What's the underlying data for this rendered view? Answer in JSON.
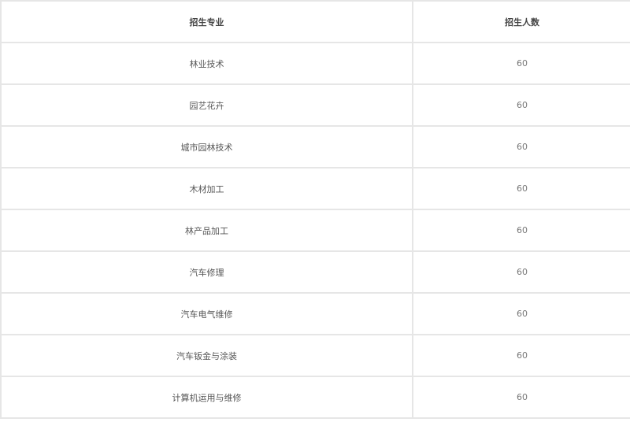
{
  "colors": {
    "accent": "#3b8fd9",
    "border": "#e6e6e6",
    "text": "#555555"
  },
  "table": {
    "headers": {
      "major": "招生专业",
      "count": "招生人数"
    },
    "rows": [
      {
        "major": "林业技术",
        "count": "60"
      },
      {
        "major": "园艺花卉",
        "count": "60"
      },
      {
        "major": "城市园林技术",
        "count": "60"
      },
      {
        "major": "木材加工",
        "count": "60"
      },
      {
        "major": "林产品加工",
        "count": "60"
      },
      {
        "major": "汽车修理",
        "count": "60"
      },
      {
        "major": "汽车电气维修",
        "count": "60"
      },
      {
        "major": "汽车钣金与涂装",
        "count": "60"
      },
      {
        "major": "计算机运用与维修",
        "count": "60"
      }
    ]
  }
}
